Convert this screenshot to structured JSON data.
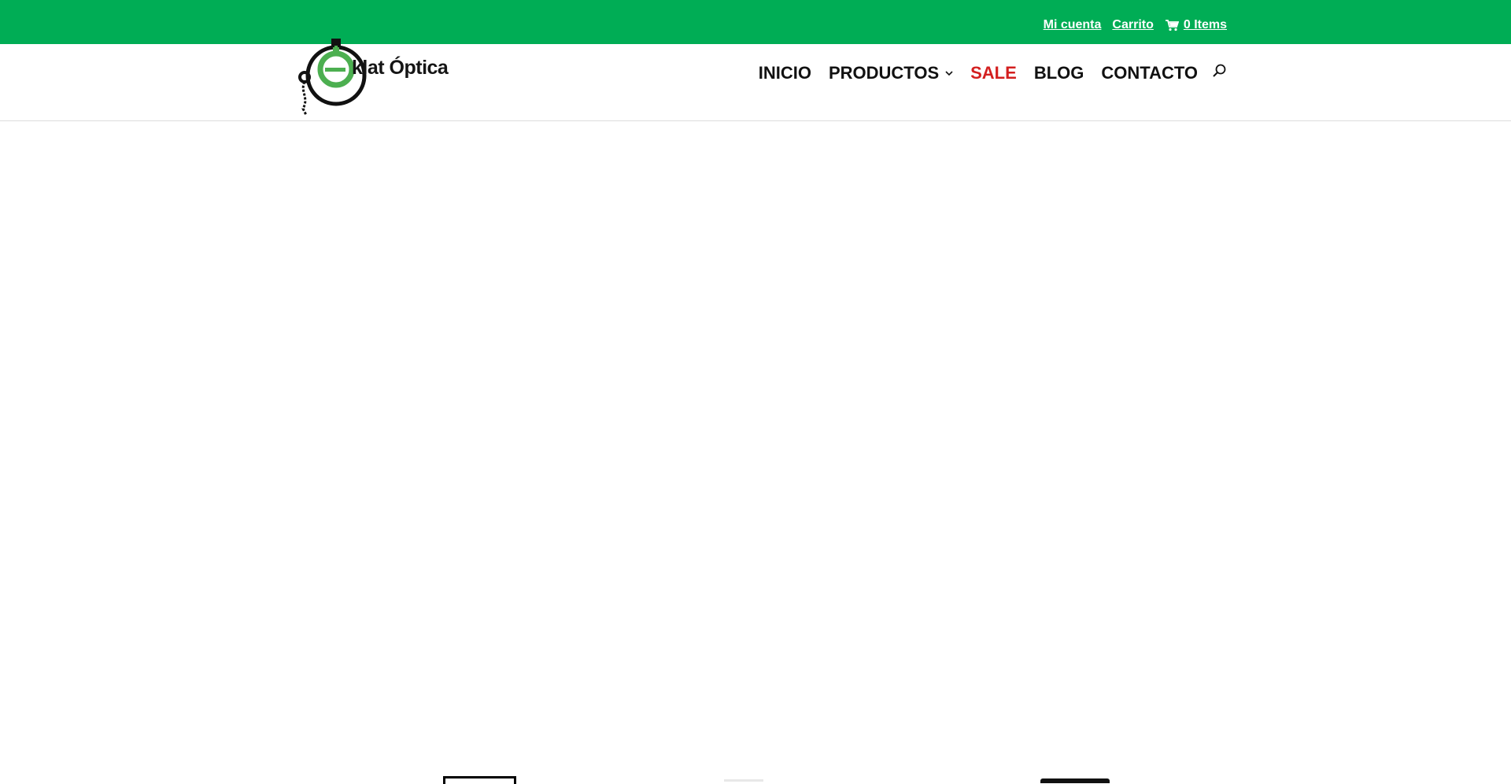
{
  "top_bar": {
    "account_label": "Mi cuenta",
    "cart_label": "Carrito",
    "items_label": "0 Items",
    "color": "#00ad55"
  },
  "logo": {
    "text": "klat Óptica",
    "accent_color": "#4caf50"
  },
  "nav": {
    "items": [
      {
        "label": "INICIO"
      },
      {
        "label": "PRODUCTOS",
        "has_dropdown": true
      },
      {
        "label": "SALE",
        "color": "#d31f1f"
      },
      {
        "label": "BLOG"
      },
      {
        "label": "CONTACTO"
      }
    ],
    "search_icon": "search-icon"
  },
  "icons": {
    "cart": "cart-icon",
    "dropdown": "chevron-down-icon"
  }
}
